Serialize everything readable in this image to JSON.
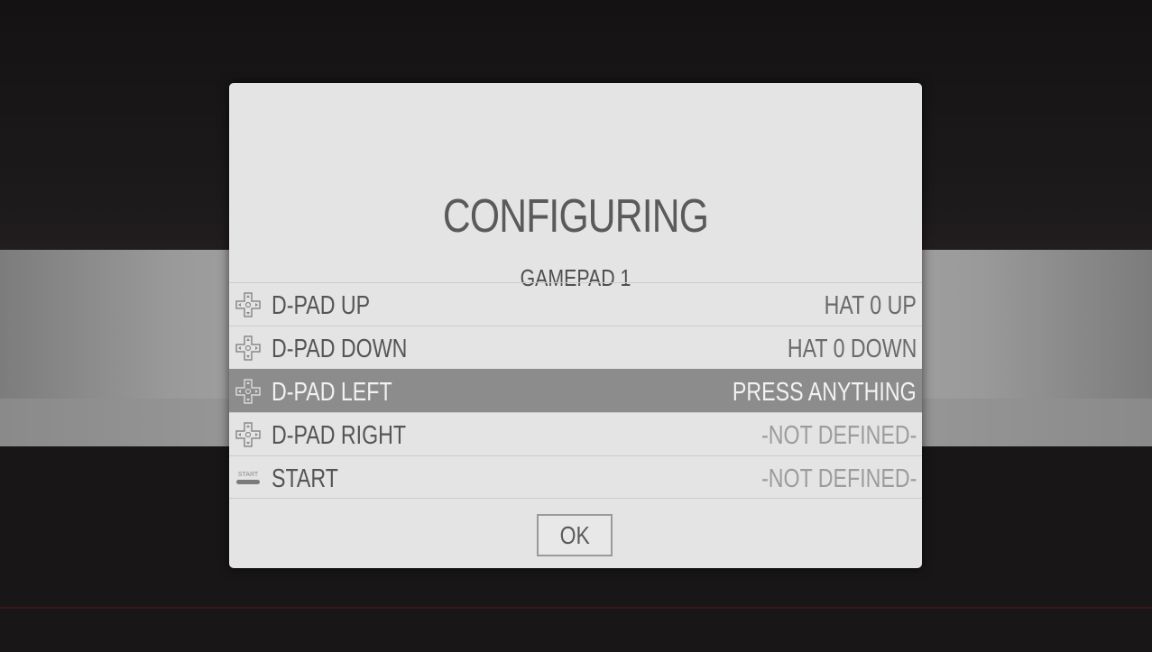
{
  "dialog": {
    "title": "CONFIGURING",
    "subtitle": "GAMEPAD 1",
    "ok_label": "OK"
  },
  "inputs": [
    {
      "label": "D-PAD UP",
      "value": "HAT 0 UP",
      "icon": "dpad-icon"
    },
    {
      "label": "D-PAD DOWN",
      "value": "HAT 0 DOWN",
      "icon": "dpad-icon"
    },
    {
      "label": "D-PAD LEFT",
      "value": "PRESS ANYTHING",
      "icon": "dpad-icon",
      "selected": true
    },
    {
      "label": "D-PAD RIGHT",
      "value": "-NOT DEFINED-",
      "icon": "dpad-icon"
    },
    {
      "label": "START",
      "value": "-NOT DEFINED-",
      "icon": "start-button-icon",
      "icon_text": "START"
    }
  ],
  "colors": {
    "dialog_bg": "#e4e4e4",
    "selected_row": "#8c8c8c",
    "text": "#555555"
  }
}
